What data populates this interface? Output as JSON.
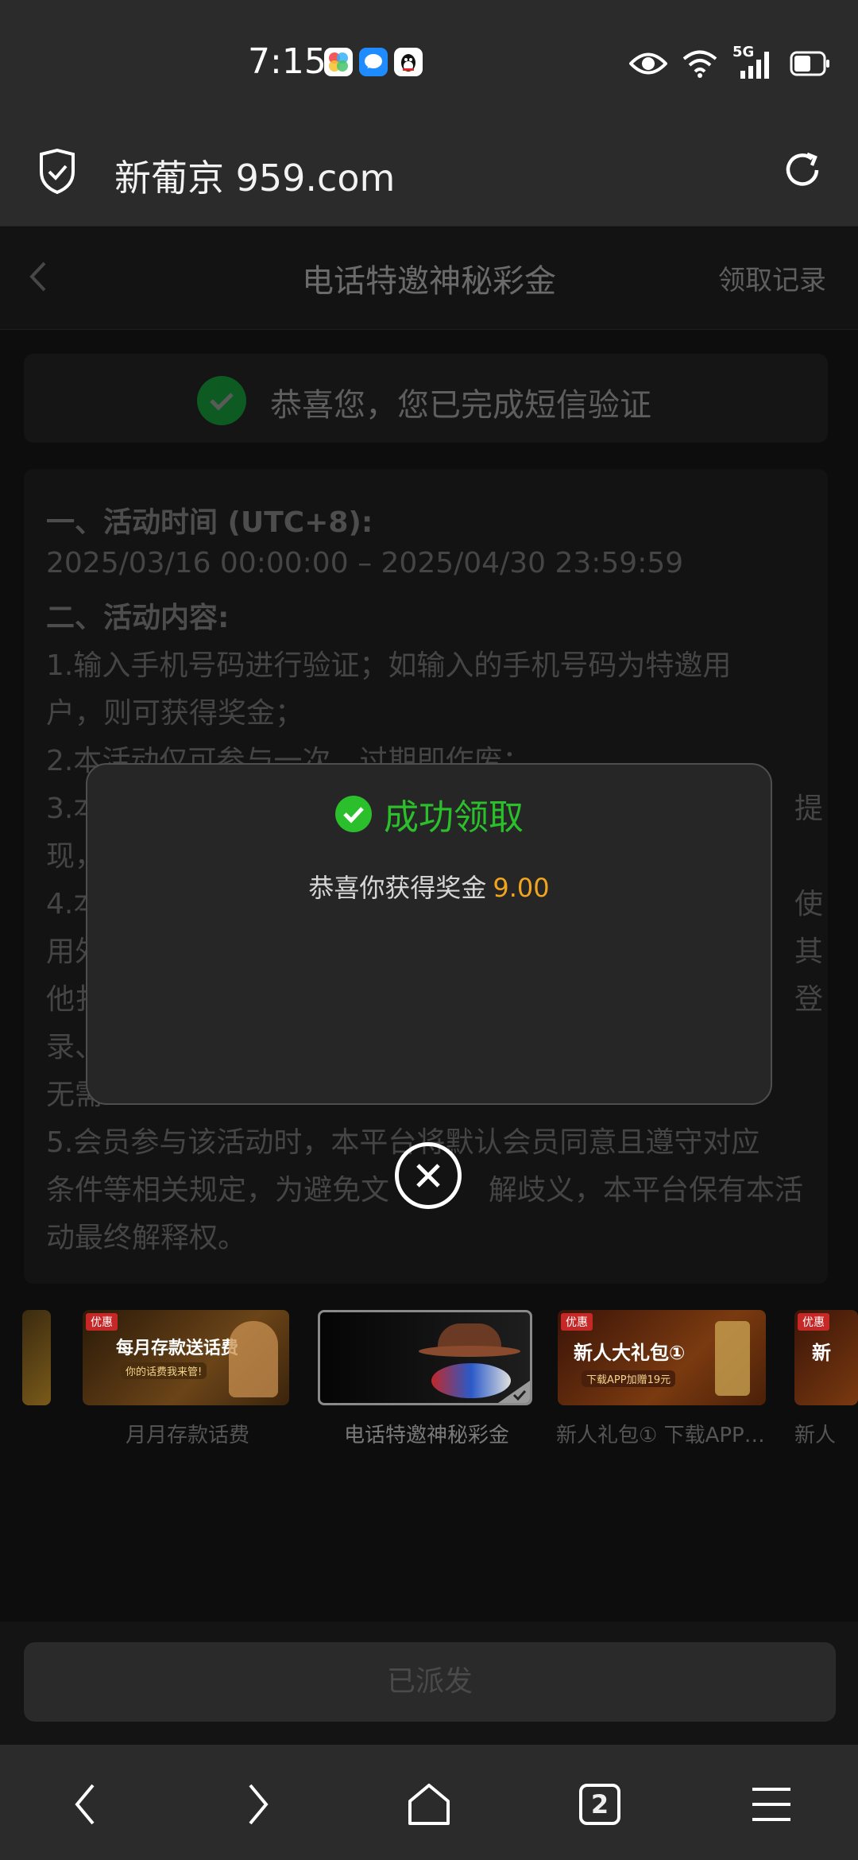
{
  "status_bar": {
    "time": "7:15",
    "network": "5G",
    "icons": [
      "gallery-app-icon",
      "message-app-icon",
      "qq-app-icon",
      "eye-icon",
      "wifi-icon",
      "signal-icon",
      "battery-icon"
    ]
  },
  "browser": {
    "url": "新葡京 959.com",
    "tab_count": "2"
  },
  "header": {
    "title": "电话特邀神秘彩金",
    "record_link": "领取记录"
  },
  "verify_banner": {
    "text": "恭喜您，您已完成短信验证"
  },
  "rules": {
    "lines": [
      "一、活动时间 (UTC+8):",
      "2025/03/16 00:00:00 – 2025/04/30 23:59:59",
      "二、活动内容:",
      "1.输入手机号码进行验证；如输入的手机号码为特邀用",
      "户，则可获得奖金；",
      "2.本活动仅可参与一次，过期即作废；",
      "3.本",
      "提",
      "现，",
      "4.本",
      "使",
      "用外",
      "其",
      "他扌",
      "登",
      "录、",
      "无需",
      "5.会员参与该活动时，本平台将默认会员同意且遵守对应",
      "条件等相关规定，为避免文",
      "解歧义，本平台保有本活",
      "动最终解释权。"
    ]
  },
  "thumbnails": [
    {
      "label": "",
      "banner_text": ""
    },
    {
      "label": "月月存款话费",
      "banner_text": "每月存款送话费",
      "sub_text": "你的话费我来管!",
      "tag": "优惠"
    },
    {
      "label": "电话特邀神秘彩金",
      "banner_text": "",
      "selected": true
    },
    {
      "label": "新人礼包① 下载APP…",
      "banner_text": "新人大礼包①",
      "sub_text": "下载APP加赠19元",
      "tag": "优惠"
    },
    {
      "label": "新人",
      "banner_text": "新",
      "tag": "优惠"
    }
  ],
  "bottom_button": {
    "label": "已派发"
  },
  "modal": {
    "title": "成功领取",
    "message": "恭喜你获得奖金",
    "amount": "9.00"
  },
  "colors": {
    "success": "#2bc02b",
    "amount": "#f0a41f",
    "modal_bg": "#262626"
  }
}
